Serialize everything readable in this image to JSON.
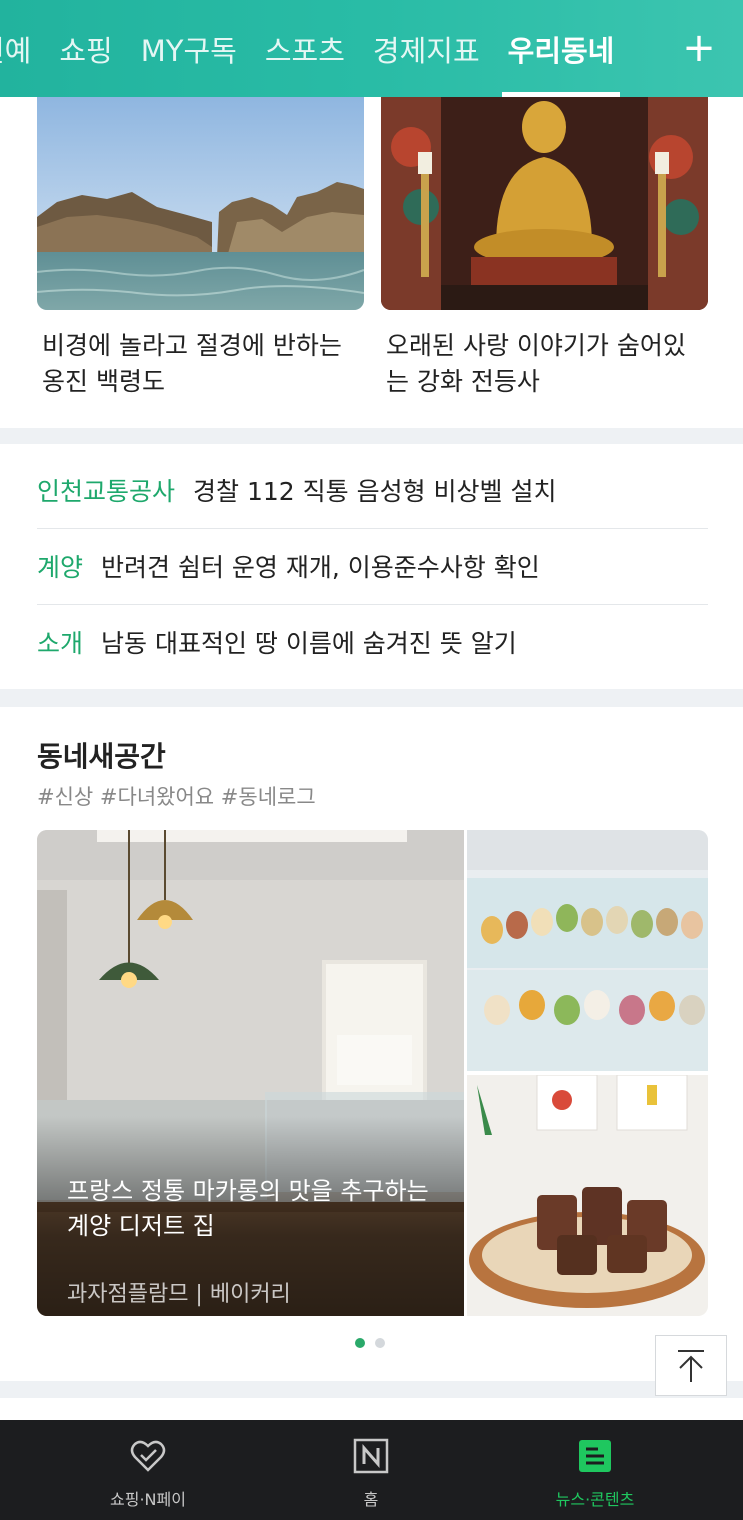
{
  "topbar": {
    "tabs": [
      "연예",
      "쇼핑",
      "MY구독",
      "스포츠",
      "경제지표",
      "우리동네"
    ],
    "active_tab": "우리동네",
    "add_label": "+"
  },
  "photo_cards": [
    {
      "title": "비경에 놀라고 절경에 반하는 옹진 백령도"
    },
    {
      "title": "오래된 사랑 이야기가 숨어있는 강화 전등사"
    }
  ],
  "news_list": [
    {
      "tag": "인천교통공사",
      "text": "경찰 112 직통 음성형 비상벨 설치"
    },
    {
      "tag": "계양",
      "text": "반려견 쉼터 운영 재개, 이용준수사항 확인"
    },
    {
      "tag": "소개",
      "text": "남동 대표적인 땅 이름에 숨겨진 뜻 알기"
    }
  ],
  "new_spaces": {
    "heading": "동네새공간",
    "hashtags": "#신상 #다녀왔어요 #동네로그",
    "featured": {
      "title": "프랑스 정통 마카롱의 맛을 추구하는 계양 디저트 집",
      "subtitle": "과자점플람므 | 베이커리"
    },
    "page_count": 2,
    "current_page": 1
  },
  "bottom_nav": {
    "items": [
      {
        "label": "쇼핑·N페이",
        "icon": "heart-check-icon"
      },
      {
        "label": "홈",
        "icon": "naver-n-icon"
      },
      {
        "label": "뉴스·콘텐츠",
        "icon": "news-content-icon"
      }
    ],
    "active": "뉴스·콘텐츠"
  },
  "colors": {
    "topbar": "#29bca6",
    "tag_green": "#1ea86c",
    "nav_active": "#1fc75f",
    "dot_active": "#2aa96a"
  }
}
